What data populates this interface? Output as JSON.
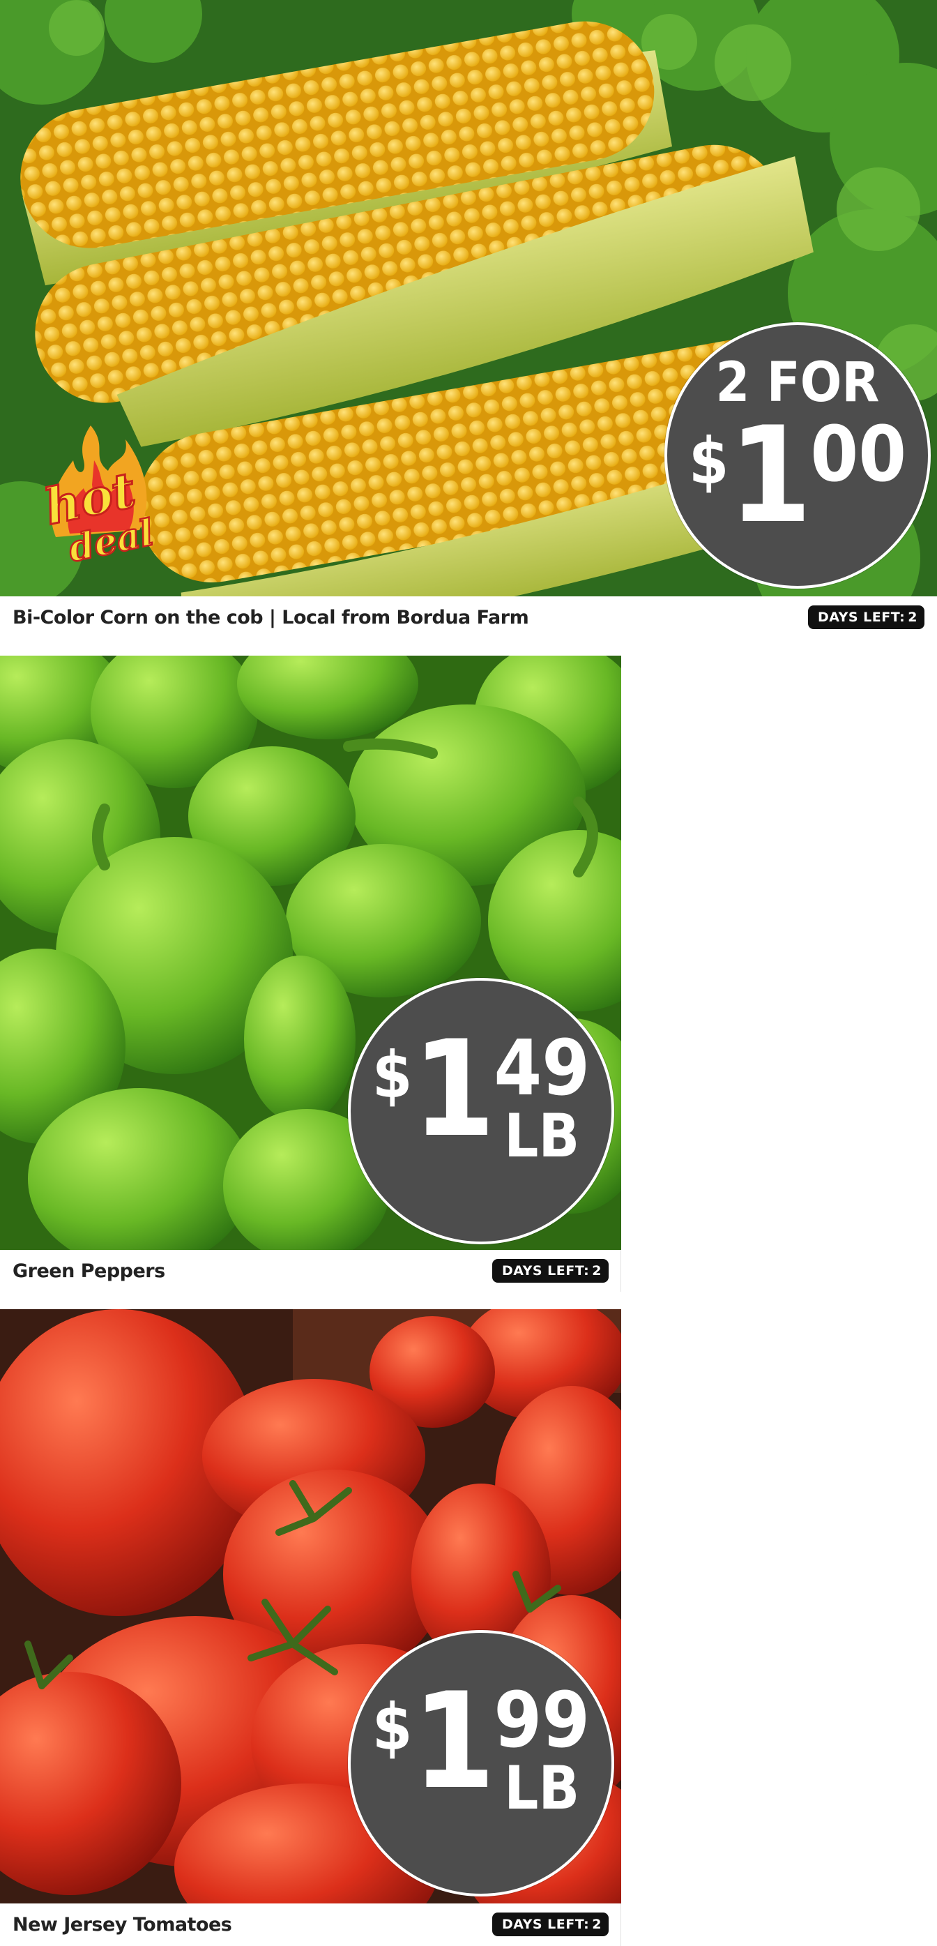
{
  "products": [
    {
      "name": "Bi-Color Corn on the cob | Local from Bordua Farm",
      "days_label": "DAYS LEFT:",
      "days_value": "2",
      "price": {
        "prefix": "2 FOR",
        "dollar": "$",
        "whole": "1",
        "cents": "00",
        "unit": ""
      },
      "badge": {
        "line1": "hot",
        "line2": "deal"
      },
      "image": "corn-on-the-cob"
    },
    {
      "name": "Green Peppers",
      "days_label": "DAYS LEFT:",
      "days_value": "2",
      "price": {
        "prefix": "",
        "dollar": "$",
        "whole": "1",
        "cents": "49",
        "unit": "LB"
      },
      "image": "green-peppers"
    },
    {
      "name": "New Jersey Tomatoes",
      "days_label": "DAYS LEFT:",
      "days_value": "2",
      "price": {
        "prefix": "",
        "dollar": "$",
        "whole": "1",
        "cents": "99",
        "unit": "LB"
      },
      "image": "tomatoes"
    }
  ],
  "colors": {
    "price_circle": "#4d4d4d",
    "days_badge": "#111111",
    "corn": "#f4c11a",
    "greens": "#3d8a26",
    "pepper": "#6fc02a",
    "tomato": "#d8301c"
  }
}
